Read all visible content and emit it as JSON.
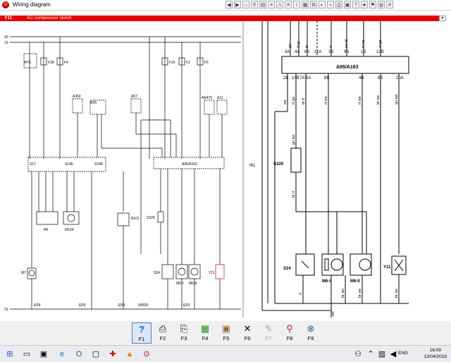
{
  "window": {
    "title": "Wiring diagram"
  },
  "header_bar": {
    "code": "Y11",
    "label": "AC compressor clutch",
    "dropdown_arrow": "▾"
  },
  "left_diagram": {
    "rails": [
      "30",
      "15",
      "31"
    ],
    "components": [
      "M76",
      "F28",
      "F4",
      "A360",
      "A34",
      "A57",
      "A6A70",
      "A11",
      "F16",
      "F2",
      "F5",
      "S17",
      "S145",
      "S148",
      "A95/A163",
      "R6",
      "M104",
      "M7",
      "B161",
      "S329",
      "S24",
      "M6-I",
      "M6-II",
      "Y11"
    ],
    "grounds": [
      "EP9",
      "EP5",
      "EP3",
      "X6825",
      "EP3"
    ]
  },
  "right_diagram": {
    "module": "A95/A163",
    "top_pins": [
      "3A",
      "4A",
      "8A",
      "11A",
      "3B",
      "9A",
      "1B",
      "13B"
    ],
    "bottom_pins": [
      "2B",
      "14B",
      "7A",
      "5A",
      "6B",
      "4B",
      "6A",
      "10A"
    ],
    "wire_colors_top": [
      "gn",
      "rt gr",
      "br",
      "rt",
      "sw bl",
      "rt ws",
      "vi ge"
    ],
    "wire_colors_bottom": [
      "ws",
      "rt ge",
      "bl rt",
      "rt ws",
      "rt sw",
      "br sw",
      "gn sw"
    ],
    "left_edge_label": "I61",
    "components": [
      "S329",
      "S24",
      "M6-I",
      "M6-II",
      "Y11"
    ],
    "switch_wires": [
      "gn sw",
      "bl rt"
    ],
    "bottom_wires": [
      "rt",
      "br sw",
      "br sw",
      "br sw"
    ],
    "ground_label": "sw"
  },
  "fkeys": [
    {
      "label": "F1",
      "icon": "help-icon",
      "glyph": "?"
    },
    {
      "label": "F2",
      "icon": "printer-icon",
      "glyph": "⎙"
    },
    {
      "label": "F3",
      "icon": "print-preview-icon",
      "glyph": "⎘"
    },
    {
      "label": "F4",
      "icon": "map-icon",
      "glyph": "▦"
    },
    {
      "label": "F5",
      "icon": "toolbox-icon",
      "glyph": "▣"
    },
    {
      "label": "F6",
      "icon": "tools-icon",
      "glyph": "✕"
    },
    {
      "label": "F7",
      "icon": "disabled-tool-icon",
      "glyph": "✎"
    },
    {
      "label": "F8",
      "icon": "magnifier-icon",
      "glyph": "⚲"
    },
    {
      "label": "F9",
      "icon": "zoom-icon",
      "glyph": "⊗"
    }
  ],
  "taskbar": {
    "language": "ENG",
    "time": "16:09",
    "date": "13/04/2018"
  },
  "colors": {
    "header_red": "#e30000",
    "accent_blue": "#5a78b8"
  }
}
